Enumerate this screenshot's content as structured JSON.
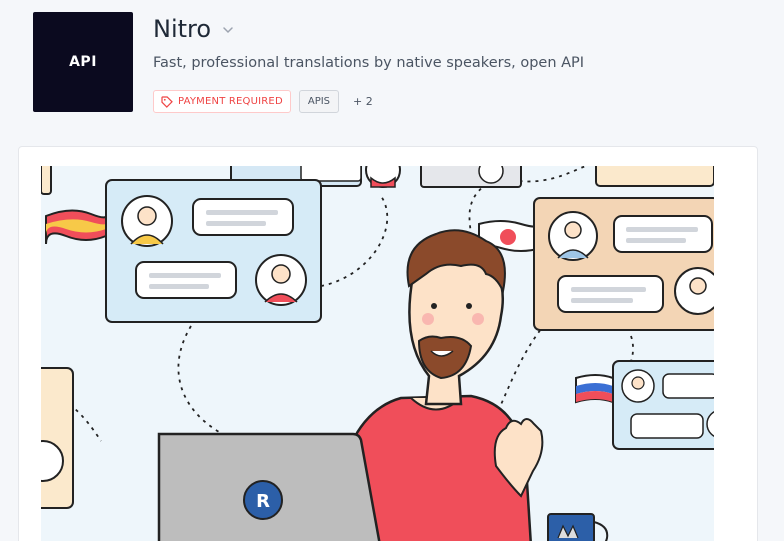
{
  "logo": {
    "text": "API"
  },
  "header": {
    "title": "Nitro",
    "description": "Fast, professional translations by native speakers, open API"
  },
  "tags": {
    "payment": "PAYMENT REQUIRED",
    "category": "APIS",
    "more": "+ 2"
  },
  "colors": {
    "logo_bg": "#0b0a1f",
    "payment_red": "#ef4444",
    "shirt_red": "#f04e5a",
    "laptop_gray": "#bdbdbd",
    "brand_blue": "#2c5fa8"
  },
  "illustration": {
    "laptop_logo": "R"
  }
}
